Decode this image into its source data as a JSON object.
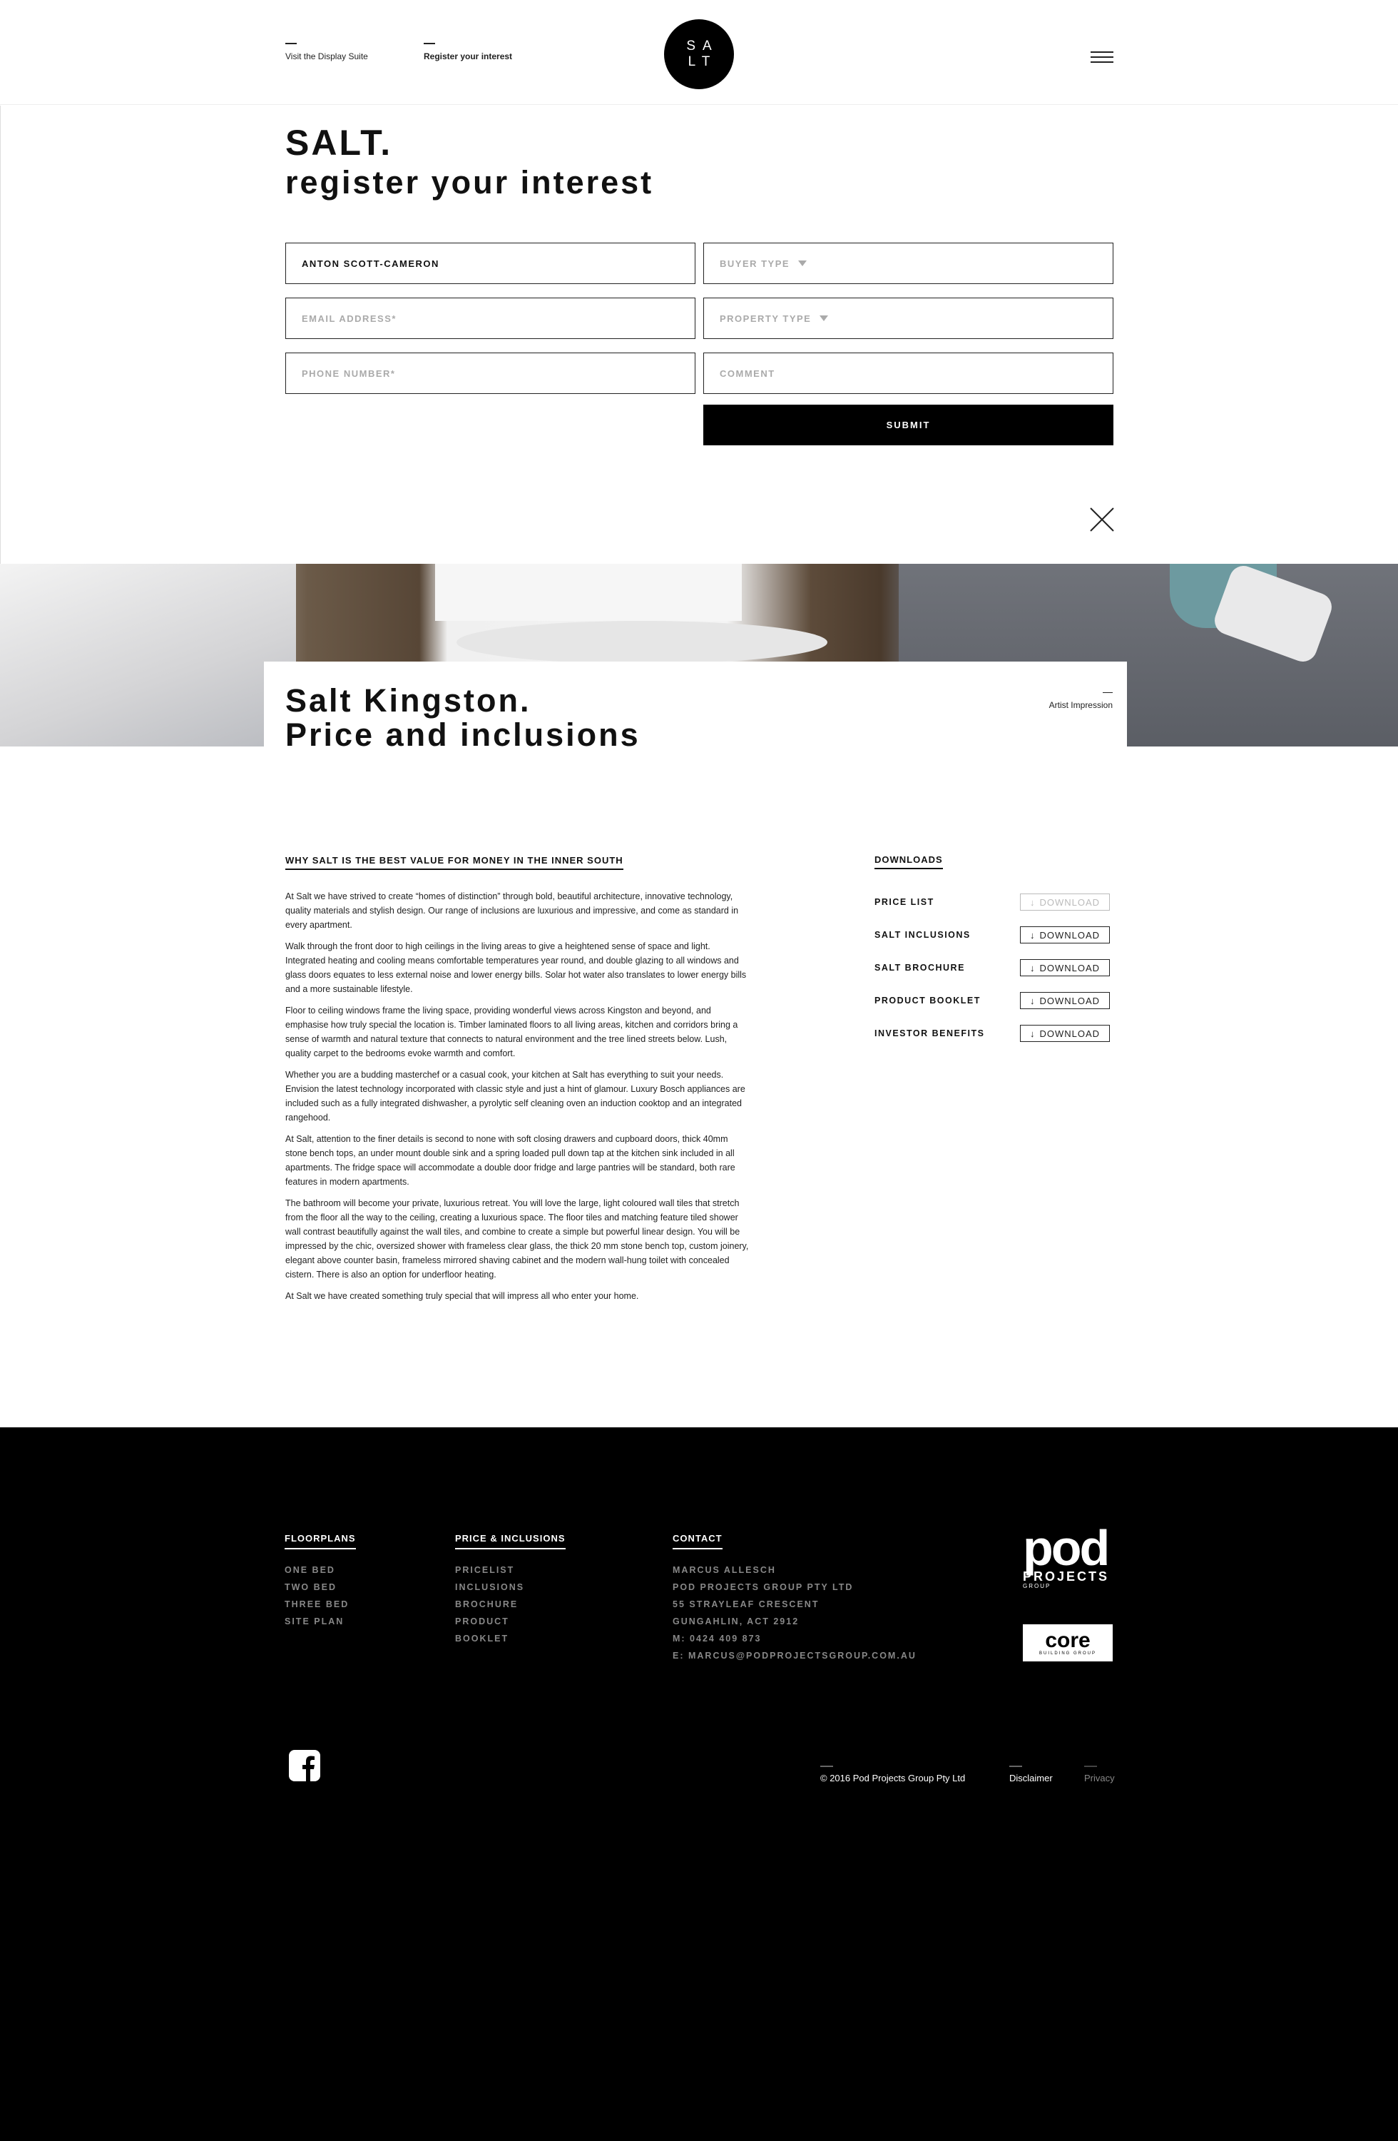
{
  "header": {
    "left_link": "Visit the Display Suite",
    "mid_link": "Register your interest",
    "logo_top": "SA",
    "logo_bottom": "LT"
  },
  "register": {
    "title": "SALT.",
    "subtitle": "register your interest",
    "name_value": "ANTON SCOTT-CAMERON",
    "email_placeholder": "EMAIL ADDRESS*",
    "phone_placeholder": "PHONE NUMBER*",
    "buyer_type_placeholder": "BUYER TYPE",
    "property_type_placeholder": "PROPERTY TYPE",
    "comment_placeholder": "COMMENT",
    "submit_label": "SUBMIT"
  },
  "hero": {
    "title_line1": "Salt Kingston.",
    "title_line2": "Price and inclusions",
    "caption": "Artist Impression"
  },
  "content": {
    "heading": "WHY SALT IS THE BEST VALUE FOR MONEY IN THE INNER SOUTH",
    "paragraphs": [
      "At Salt we have strived to create “homes of distinction” through bold, beautiful architecture, innovative technology, quality materials and stylish design. Our range of inclusions are luxurious and impressive, and come as standard in every apartment.",
      "Walk through the front door to high ceilings in the living areas to give a heightened sense of space and light. Integrated heating and cooling means comfortable temperatures year round, and double glazing to all windows and glass doors equates to less external noise and lower energy bills. Solar hot water also translates to lower energy bills and a more sustainable lifestyle.",
      "Floor to ceiling windows frame the living space, providing wonderful views across Kingston and beyond, and emphasise how truly special the location is. Timber laminated floors to all living areas, kitchen and corridors bring a sense of warmth and natural texture that connects to natural environment and the tree lined streets below. Lush, quality carpet to the bedrooms evoke warmth and comfort.",
      "Whether you are a budding masterchef or a casual cook, your kitchen at Salt has everything to suit your needs. Envision the latest technology incorporated with classic style and just a hint of glamour. Luxury Bosch appliances are included such as a fully integrated dishwasher, a pyrolytic self cleaning oven an induction cooktop and an integrated rangehood.",
      "At Salt, attention to the finer details is second to none with soft closing drawers and cupboard doors, thick 40mm stone bench tops, an under mount double sink and a spring loaded pull down tap at the kitchen sink included in all apartments. The fridge space will accommodate a double door fridge and large pantries will be standard, both rare features in modern apartments.",
      "The bathroom will become your private, luxurious retreat. You will love the large, light coloured wall tiles that stretch from the floor all the way to the ceiling, creating a luxurious space. The floor tiles and matching feature tiled shower wall contrast beautifully against the wall tiles, and combine to create a simple but powerful linear design. You will be impressed by the chic, oversized shower with frameless clear glass, the thick 20 mm stone bench top, custom joinery, elegant above counter basin, frameless mirrored shaving cabinet and the modern wall-hung toilet with concealed cistern. There is also an option for underfloor heating.",
      "At Salt we have created something truly special that will impress all who enter your home."
    ]
  },
  "downloads": {
    "heading": "DOWNLOADS",
    "button_label": "DOWNLOAD",
    "items": [
      {
        "label": "PRICE LIST"
      },
      {
        "label": "SALT INCLUSIONS"
      },
      {
        "label": "SALT BROCHURE"
      },
      {
        "label": "PRODUCT BOOKLET"
      },
      {
        "label": "INVESTOR BENEFITS"
      }
    ]
  },
  "footer": {
    "floorplans": {
      "heading": "FLOORPLANS",
      "items": [
        "ONE BED",
        "TWO BED",
        "THREE BED",
        "SITE PLAN"
      ]
    },
    "price": {
      "heading": "PRICE & INCLUSIONS",
      "items": [
        "PRICELIST",
        "INCLUSIONS",
        "BROCHURE",
        "PRODUCT",
        "BOOKLET"
      ]
    },
    "contact": {
      "heading": "CONTACT",
      "items": [
        "MARCUS ALLESCH",
        "POD PROJECTS GROUP PTY LTD",
        "55 STRAYLEAF CRESCENT",
        "GUNGAHLIN, ACT 2912",
        "M: 0424 409 873",
        "E: MARCUS@PODPROJECTSGROUP.COM.AU"
      ]
    },
    "pod_logo_main": "pod",
    "pod_logo_sub": "PROJECTS",
    "pod_logo_group": "GROUP",
    "core_logo_main": "core",
    "core_logo_sub": "BUILDING GROUP",
    "copyright": "© 2016 Pod Projects Group Pty Ltd",
    "disclaimer": "Disclaimer",
    "privacy": "Privacy"
  }
}
